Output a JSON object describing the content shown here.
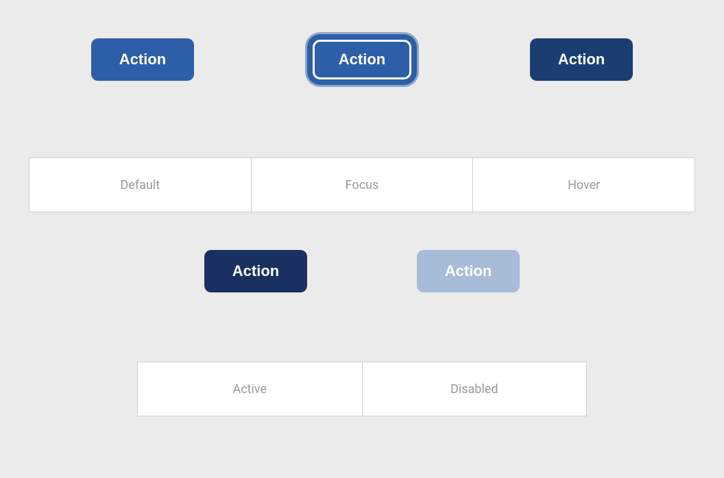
{
  "top_row": {
    "btn_default_label": "Action",
    "btn_focus_label": "Action",
    "btn_hover_label": "Action"
  },
  "label_row": {
    "default_label": "Default",
    "focus_label": "Focus",
    "hover_label": "Hover"
  },
  "bottom_row": {
    "btn_active_label": "Action",
    "btn_disabled_label": "Action"
  },
  "bottom_label_row": {
    "active_label": "Active",
    "disabled_label": "Disabled"
  }
}
